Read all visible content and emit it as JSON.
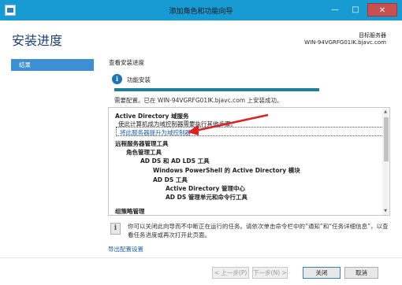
{
  "window": {
    "title": "添加角色和功能向导",
    "buttons": {
      "minimize": "—",
      "maximize": "□",
      "close": "✕"
    }
  },
  "header": {
    "title": "安装进度",
    "destination_label": "目标服务器",
    "destination_server": "WIN-94VGRFG01IK.bjavc.com"
  },
  "nav": {
    "items": [
      {
        "label": "结果",
        "active": true
      }
    ]
  },
  "content": {
    "title": "查看安装进度",
    "status_label": "功能安装",
    "progress_percent": 100,
    "status_detail": "需要配置。已在 WIN-94VGRFG01IK.bjavc.com 上安装成功。",
    "results": [
      {
        "text": "Active Directory 域服务",
        "bold": true
      },
      {
        "text": "使此计算机成为域控制器需要执行其他步骤。",
        "bold": false
      },
      {
        "text": "将此服务器提升为域控制器",
        "link": true
      },
      {
        "text": "远程服务器管理工具",
        "bold": true
      },
      {
        "text": "角色管理工具",
        "bold": true
      },
      {
        "text": "AD DS 和 AD LDS 工具",
        "bold": true
      },
      {
        "text": "Windows PowerShell 的 Active Directory 模块",
        "bold": true
      },
      {
        "text": "AD DS 工具",
        "bold": true
      },
      {
        "text": "Active Directory 管理中心",
        "bold": true
      },
      {
        "text": "AD DS 管理单元和命令行工具",
        "bold": true
      },
      {
        "text": "组策略管理",
        "bold": true
      }
    ],
    "note": "你可以关闭此向导而不中断正在运行的任务。请依次单击命令栏中的“通知”和“任务详细信息”，以查看任务进度或再次打开此页面。",
    "export_link": "导出配置设置"
  },
  "footer": {
    "prev": "< 上一步(P)",
    "next": "下一步(N) >",
    "close": "关闭",
    "cancel": "取消"
  },
  "colors": {
    "titlebar": "#189ad3",
    "accent": "#3c8fd3",
    "progress": "#1f7f98",
    "link": "#1f5fa9",
    "annotation_arrow": "#e02020"
  }
}
